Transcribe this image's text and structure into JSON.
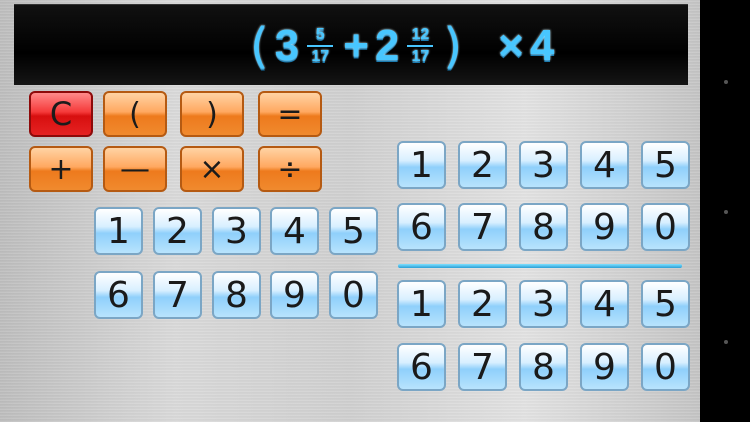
{
  "expression": {
    "open_paren": "(",
    "whole1": "3",
    "num1": "5",
    "den1": "17",
    "plus": "+",
    "whole2": "2",
    "num2": "12",
    "den2": "17",
    "close_paren": ")",
    "times": "×",
    "multiplier": "4"
  },
  "operators": {
    "clear": "C",
    "open_paren": "(",
    "close_paren": ")",
    "equals": "=",
    "plus": "+",
    "minus": "—",
    "times": "×",
    "divide": "÷"
  },
  "keypads": {
    "whole": {
      "row1": [
        "1",
        "2",
        "3",
        "4",
        "5"
      ],
      "row2": [
        "6",
        "7",
        "8",
        "9",
        "0"
      ]
    },
    "numerator": {
      "row1": [
        "1",
        "2",
        "3",
        "4",
        "5"
      ],
      "row2": [
        "6",
        "7",
        "8",
        "9",
        "0"
      ]
    },
    "denominator": {
      "row1": [
        "1",
        "2",
        "3",
        "4",
        "5"
      ],
      "row2": [
        "6",
        "7",
        "8",
        "9",
        "0"
      ]
    }
  },
  "colors": {
    "display_text": "#48c6ff",
    "clear_button": "#e52222",
    "operator_button": "#f08a2e",
    "digit_button": "#8fd0fb"
  }
}
